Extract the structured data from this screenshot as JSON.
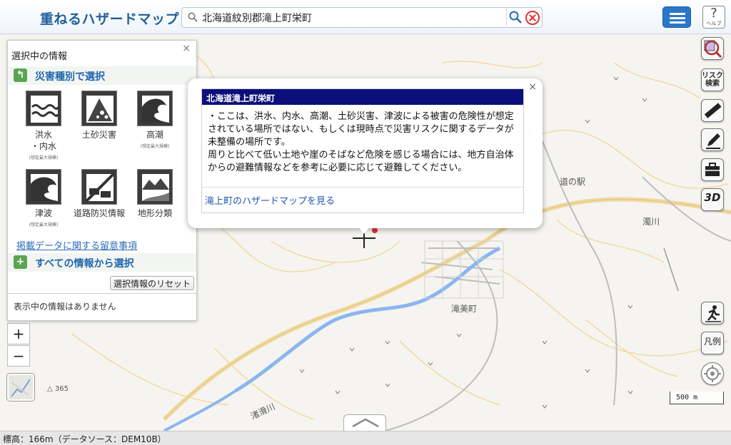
{
  "header": {
    "title": "重ねるハザードマップ",
    "search_value": "北海道紋別郡滝上町栄町",
    "help_label": "ヘルプ"
  },
  "panel": {
    "title": "選択中の情報",
    "close_label": "×",
    "by_type_label": "災害種別で選択",
    "hazards": [
      {
        "name": "洪水\n・内水",
        "note": "(想定最大規模)"
      },
      {
        "name": "土砂災害",
        "note": ""
      },
      {
        "name": "高潮",
        "note": "(想定最大規模)"
      },
      {
        "name": "津波",
        "note": "(想定最大規模)"
      },
      {
        "name": "道路防災情報",
        "note": ""
      },
      {
        "name": "地形分類",
        "note": ""
      }
    ],
    "notice_link": "掲載データに関する留意事項",
    "all_info_label": "すべての情報から選択",
    "reset_label": "選択情報のリセット",
    "empty_message": "表示中の情報はありません"
  },
  "popup": {
    "title": "北海道滝上町栄町",
    "body_1": "・ここは、洪水、内水、高潮、土砂災害、津波による被害の危険性が想定されている場所ではない、もしくは現時点で災害リスクに関するデータが未整備の場所です。",
    "body_2": "周りと比べて低い土地や崖のそばなど危険を感じる場合には、地方自治体からの避難情報などを参考に必要に応じて避難してください。",
    "link": "滝上町のハザードマップを見る",
    "close_label": "×"
  },
  "tools": {
    "risk_search_label": "リスク\n検索",
    "three_d_label": "3D",
    "legend_label": "凡例"
  },
  "map": {
    "labels": {
      "michi_no_eki": "道の駅",
      "nigorikawa": "濁川",
      "takimicho": "滝美町",
      "nagisatakigawa": "渚滑川",
      "elevation_365": "365"
    },
    "scale_label": "500 m",
    "zoom_in": "+",
    "zoom_out": "−"
  },
  "footer": {
    "status": "標高：166m（データソース：DEM10B）"
  },
  "colors": {
    "accent": "#1f66ad",
    "popup_header": "#0b0f7a",
    "river": "#8ab6f0",
    "road": "#f0d9a0",
    "contour": "#f2d58a"
  }
}
